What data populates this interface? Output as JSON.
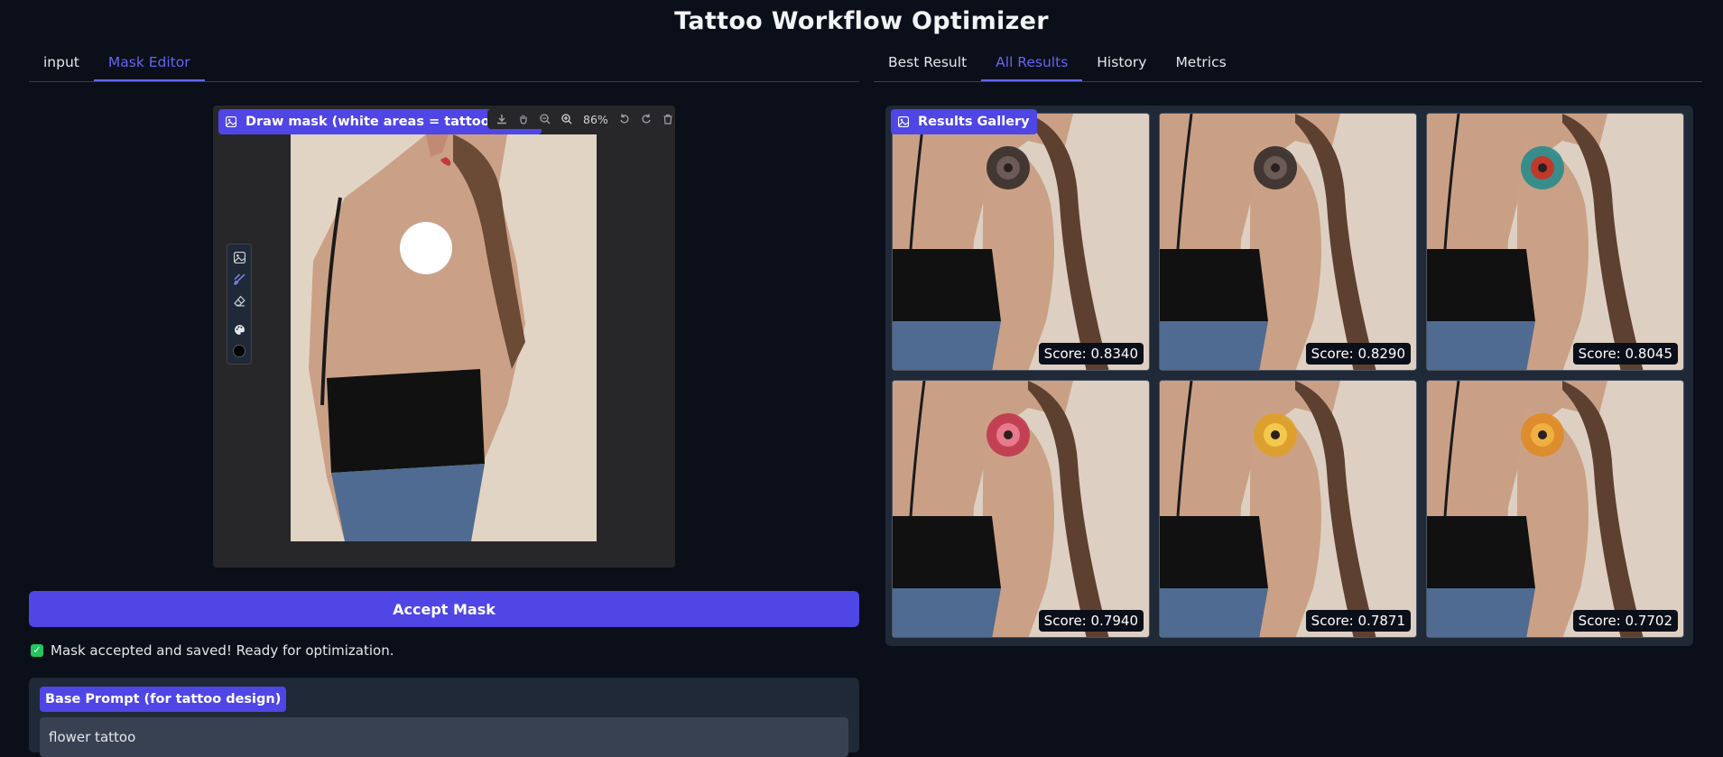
{
  "app": {
    "title": "Tattoo Workflow Optimizer"
  },
  "left_tabs": [
    {
      "label": "input",
      "active": false
    },
    {
      "label": "Mask Editor",
      "active": true
    }
  ],
  "right_tabs": [
    {
      "label": "Best Result",
      "active": false
    },
    {
      "label": "All Results",
      "active": true
    },
    {
      "label": "History",
      "active": false
    },
    {
      "label": "Metrics",
      "active": false
    }
  ],
  "editor": {
    "label": "Draw mask (white areas = tattoo placement)",
    "zoom": "86%",
    "toolbar_icons": [
      "download-icon",
      "pan-icon",
      "zoom-out-icon",
      "zoom-in-icon",
      "undo-icon",
      "redo-icon",
      "trash-icon"
    ],
    "tool_icons": [
      "image-icon",
      "brush-icon",
      "eraser-icon",
      "palette-icon",
      "color-swatch-icon"
    ],
    "brush_color": "#000000"
  },
  "accept_button": {
    "label": "Accept Mask"
  },
  "status": {
    "text": "Mask accepted and saved! Ready for optimization."
  },
  "prompt": {
    "label": "Base Prompt (for tattoo design)",
    "value": "flower tattoo"
  },
  "gallery": {
    "label": "Results Gallery",
    "items": [
      {
        "score": "Score: 0.8340",
        "tattoo": "dark-flower"
      },
      {
        "score": "Score: 0.8290",
        "tattoo": "dark-flower"
      },
      {
        "score": "Score: 0.8045",
        "tattoo": "teal-red-flower"
      },
      {
        "score": "Score: 0.7940",
        "tattoo": "red-flower"
      },
      {
        "score": "Score: 0.7871",
        "tattoo": "yellow-flower"
      },
      {
        "score": "Score: 0.7702",
        "tattoo": "orange-flower"
      }
    ]
  },
  "colors": {
    "accent": "#4f46e5",
    "active_tab": "#6366f1",
    "background": "#0b0f19"
  }
}
